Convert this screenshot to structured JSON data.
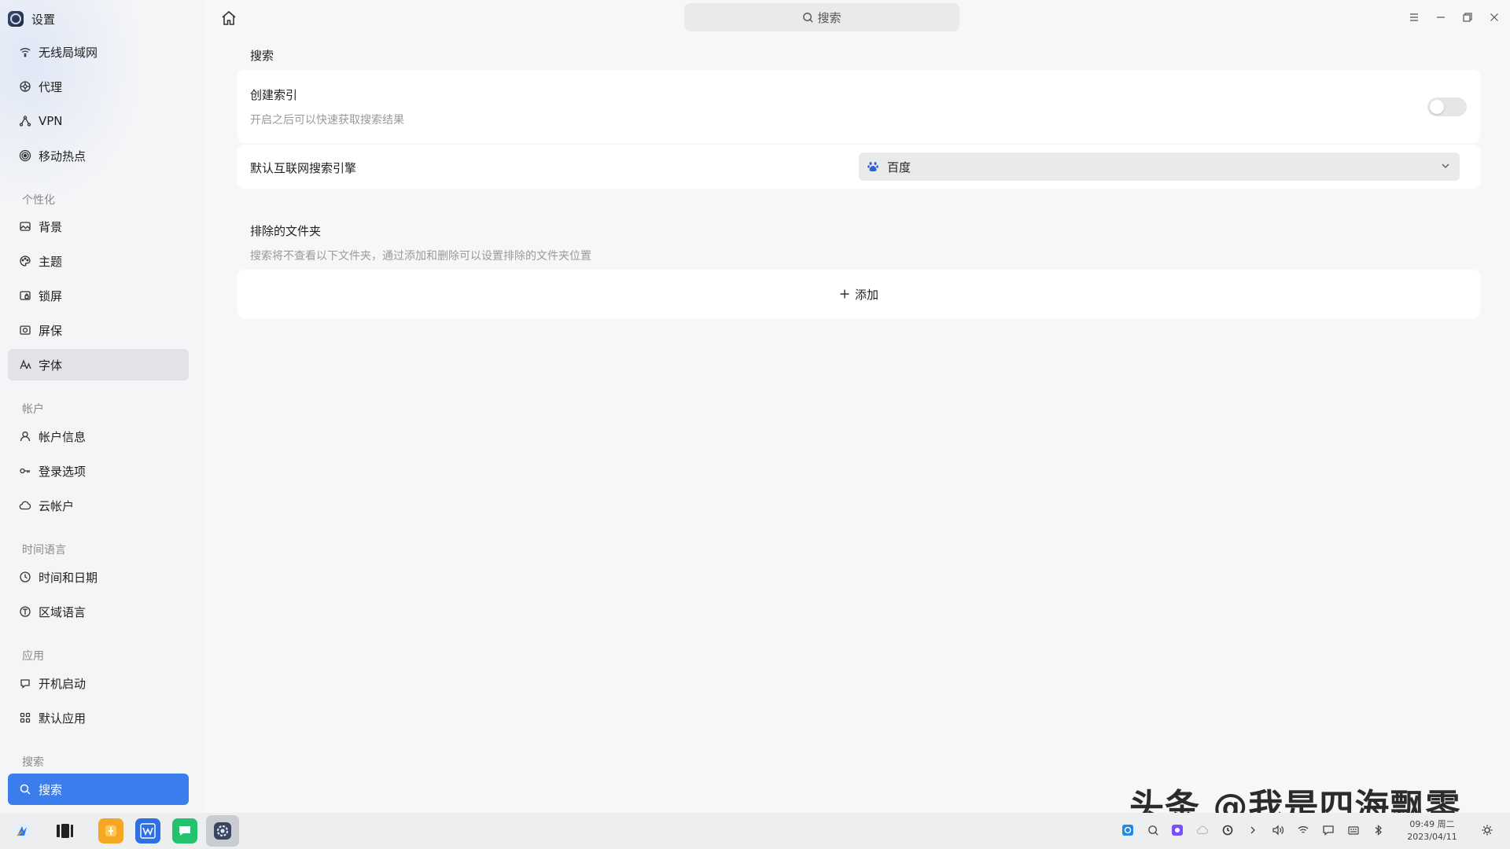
{
  "app": {
    "title": "设置"
  },
  "search": {
    "placeholder": "搜索"
  },
  "sidebar": {
    "network_items": [
      {
        "label": "无线局域网",
        "icon": "wifi-icon"
      },
      {
        "label": "代理",
        "icon": "proxy-icon"
      },
      {
        "label": "VPN",
        "icon": "vpn-icon"
      },
      {
        "label": "移动热点",
        "icon": "hotspot-icon"
      }
    ],
    "personalization": {
      "label": "个性化",
      "items": [
        {
          "label": "背景",
          "icon": "image-icon"
        },
        {
          "label": "主题",
          "icon": "palette-icon"
        },
        {
          "label": "锁屏",
          "icon": "lock-screen-icon"
        },
        {
          "label": "屏保",
          "icon": "screensaver-icon"
        },
        {
          "label": "字体",
          "icon": "font-icon"
        }
      ]
    },
    "account": {
      "label": "帐户",
      "items": [
        {
          "label": "帐户信息",
          "icon": "user-icon"
        },
        {
          "label": "登录选项",
          "icon": "key-icon"
        },
        {
          "label": "云帐户",
          "icon": "cloud-icon"
        }
      ]
    },
    "time_language": {
      "label": "时间语言",
      "items": [
        {
          "label": "时间和日期",
          "icon": "clock-icon"
        },
        {
          "label": "区域语言",
          "icon": "language-icon"
        }
      ]
    },
    "apps": {
      "label": "应用",
      "items": [
        {
          "label": "开机启动",
          "icon": "startup-icon"
        },
        {
          "label": "默认应用",
          "icon": "grid-icon"
        }
      ]
    },
    "search_group": {
      "label": "搜索",
      "items": [
        {
          "label": "搜索",
          "icon": "search-icon"
        }
      ]
    }
  },
  "main": {
    "search_section_title": "搜索",
    "create_index": {
      "title": "创建索引",
      "description": "开启之后可以快速获取搜索结果",
      "enabled": false
    },
    "default_engine": {
      "label": "默认互联网搜索引擎",
      "value": "百度"
    },
    "excluded_folders": {
      "title": "排除的文件夹",
      "description": "搜索将不查看以下文件夹，通过添加和删除可以设置排除的文件夹位置",
      "add_label": "添加"
    }
  },
  "taskbar": {
    "time": "09:49 周二",
    "date": "2023/04/11"
  },
  "watermark": "头条 @我是四海飘零",
  "colors": {
    "accent": "#3b7ded",
    "selected_gray": "#e2e3e6"
  }
}
